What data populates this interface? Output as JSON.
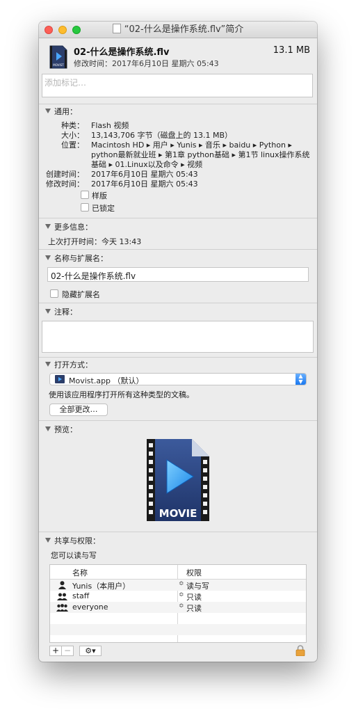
{
  "window": {
    "title": "“02-什么是操作系统.flv”简介"
  },
  "header": {
    "file_name": "02-什么是操作系统.flv",
    "file_size": "13.1 MB",
    "modified": "修改时间：2017年6月10日 星期六 05:43",
    "tags_placeholder": "添加标记…",
    "icon_label": "MOVIST"
  },
  "general": {
    "heading": "通用：",
    "kind_label": "种类：",
    "kind": "Flash 视频",
    "size_label": "大小：",
    "size": "13,143,706 字节（磁盘上的 13.1 MB）",
    "where_label": "位置：",
    "where_line1": "Macintosh HD ▸ 用户 ▸ Yunis ▸ 音乐 ▸ baidu ▸ Python ▸",
    "where_line2": "python最新就业班 ▸ 第1章 python基础 ▸ 第1节 linux操作系统",
    "where_line3": "基础 ▸ 01.Linux以及命令 ▸ 视频",
    "created_label": "创建时间：",
    "created": "2017年6月10日 星期六 05:43",
    "modified_label": "修改时间：",
    "modified": "2017年6月10日 星期六 05:43",
    "stationery": "样版",
    "locked": "已锁定"
  },
  "more_info": {
    "heading": "更多信息：",
    "last_opened": "上次打开时间：今天 13:43"
  },
  "name_ext": {
    "heading": "名称与扩展名：",
    "value": "02-什么是操作系统.flv",
    "hide_ext": "隐藏扩展名"
  },
  "comments": {
    "heading": "注释："
  },
  "open_with": {
    "heading": "打开方式：",
    "app": "Movist.app （默认）",
    "note": "使用该应用程序打开所有这种类型的文稿。",
    "change_all": "全部更改…"
  },
  "preview": {
    "heading": "预览：",
    "icon_text": "MOVIE"
  },
  "sharing": {
    "heading": "共享与权限：",
    "summary": "您可以读与写",
    "col_name": "名称",
    "col_priv": "权限",
    "rows": [
      {
        "name": "Yunis（本用户）",
        "priv": "读与写",
        "icon": "single-user-icon"
      },
      {
        "name": "staff",
        "priv": "只读",
        "icon": "group-icon"
      },
      {
        "name": "everyone",
        "priv": "只读",
        "icon": "everyone-icon"
      }
    ],
    "add": "+",
    "remove": "−",
    "gear": "⚙▾"
  }
}
